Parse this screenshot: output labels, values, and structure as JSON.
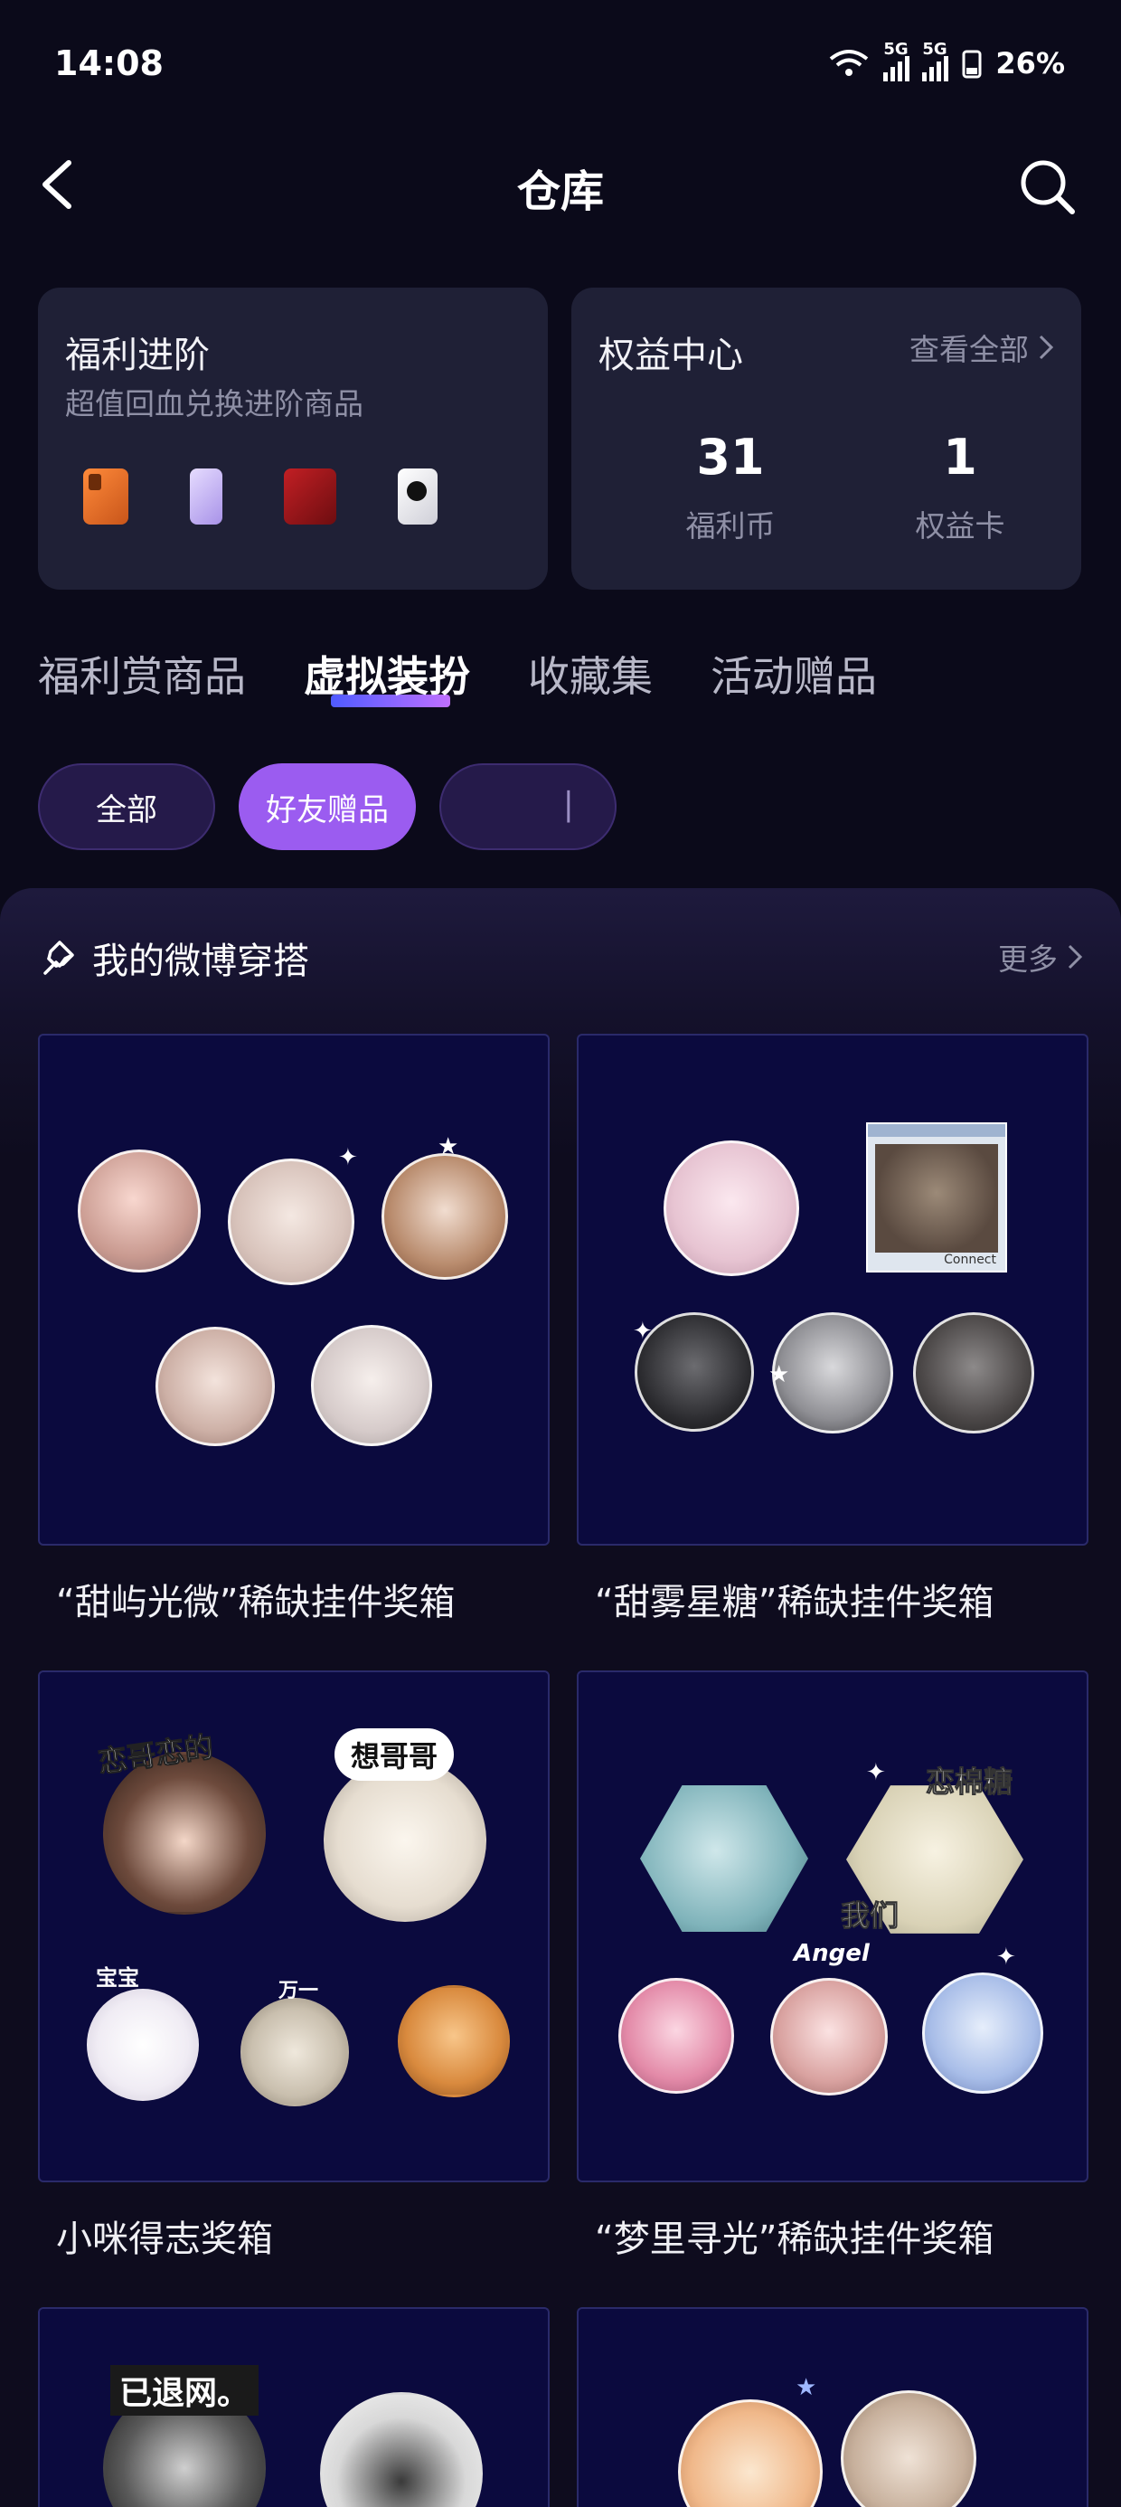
{
  "status_bar": {
    "time": "14:08",
    "network_1": "5G",
    "network_2": "5G",
    "battery": "26%"
  },
  "header": {
    "title": "仓库",
    "back_icon": "chevron-left-icon",
    "search_icon": "search-icon"
  },
  "welfare_card": {
    "title": "福利进阶",
    "subtitle": "超值回血兑换进阶商品"
  },
  "rights_card": {
    "title": "权益中心",
    "view_all": "查看全部",
    "stats": [
      {
        "value": "31",
        "label": "福利币"
      },
      {
        "value": "1",
        "label": "权益卡"
      }
    ]
  },
  "tabs": [
    "福利赏商品",
    "虚拟装扮",
    "收藏集",
    "活动赠品"
  ],
  "active_tab": "虚拟装扮",
  "chips": [
    "全部",
    "好友赠品",
    "                                                                "
  ],
  "active_chip": "好友赠品",
  "section": {
    "title": "我的微博穿搭",
    "more": "更多"
  },
  "items": [
    {
      "name": "“甜屿光微”稀缺挂件奖箱"
    },
    {
      "name": "“甜雾星糖”稀缺挂件奖箱"
    },
    {
      "name": "小咪得志奖箱"
    },
    {
      "name": "“梦里寻光”稀缺挂件奖箱"
    }
  ],
  "image_texts": {
    "t1": "恋哥恋的",
    "t2": "想哥哥",
    "t3": "宝宝",
    "t4": "万一",
    "t5": "恋棉糖",
    "t6": "我们",
    "t7": "Angel",
    "t8": "已退网。",
    "t9": "Connect"
  },
  "colors": {
    "background": "#0b0a1a",
    "card": "#1f2036",
    "accent_chip": "#9b5cf0",
    "thumb_bg": "#0b0a3e",
    "muted_text": "#8f90a6"
  }
}
